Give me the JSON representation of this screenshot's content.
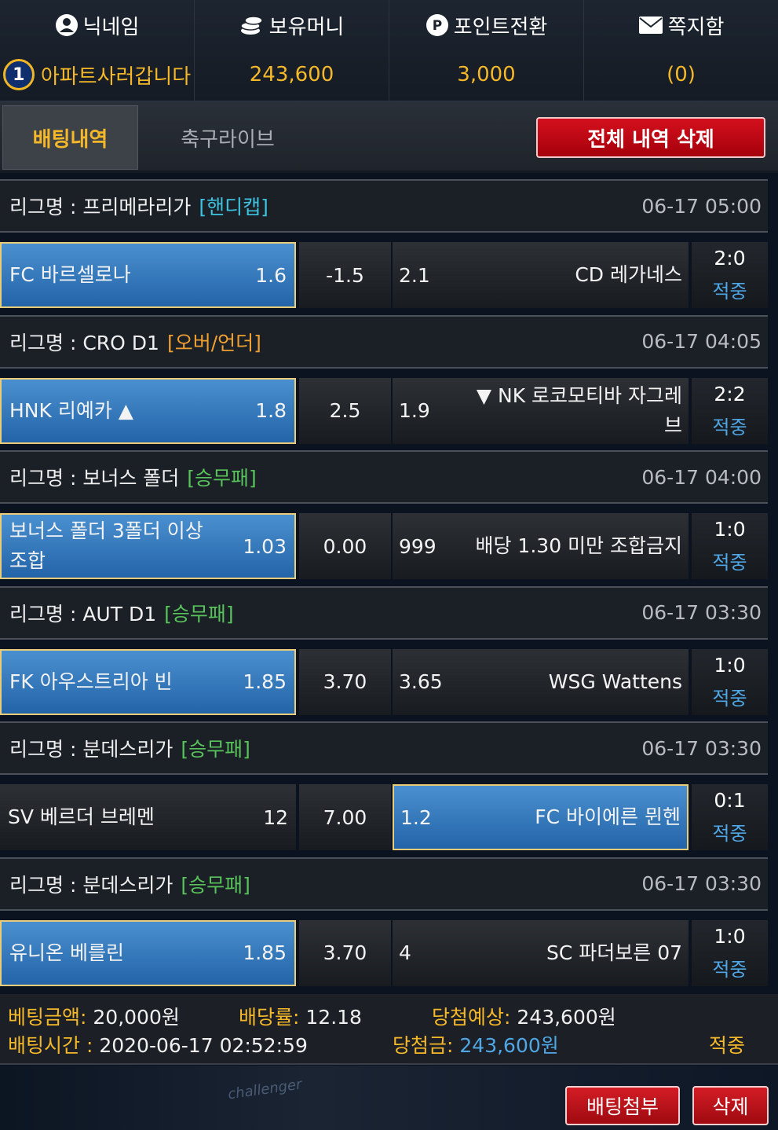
{
  "header": {
    "columns": [
      {
        "label": "닉네임",
        "icon": "user-circle-icon",
        "value": "아파트사러갑니다",
        "level": "1"
      },
      {
        "label": "보유머니",
        "icon": "coins-icon",
        "value": "243,600"
      },
      {
        "label": "포인트전환",
        "icon": "point-p-icon",
        "value": "3,000"
      },
      {
        "label": "쪽지함",
        "icon": "envelope-icon",
        "value": "(0)"
      }
    ]
  },
  "tabs": {
    "active": "배팅내역",
    "inactive": "축구라이브",
    "delete_all": "전체 내역 삭제"
  },
  "league_prefix": "리그명 : ",
  "matches": [
    {
      "league": "프리메라리가",
      "tag": "[핸디캡]",
      "tag_color": "#3cc3e0",
      "time": "06-17 05:00",
      "home": "FC 바르셀로나",
      "home_odds": "1.6",
      "line": "-1.5",
      "away_odds": "2.1",
      "away": "CD 레가네스",
      "score": "2:0",
      "status": "적중",
      "selected": "home"
    },
    {
      "league": "CRO D1",
      "tag": "[오버/언더]",
      "tag_color": "#f0a030",
      "time": "06-17 04:05",
      "home": "HNK 리예카 ▲",
      "home_odds": "1.8",
      "line": "2.5",
      "away_odds": "1.9",
      "away": "▼ NK 로코모티바 자그레브",
      "score": "2:2",
      "status": "적중",
      "selected": "home"
    },
    {
      "league": "보너스 폴더",
      "tag": "[승무패]",
      "tag_color": "#58c35a",
      "time": "06-17 04:00",
      "home": "보너스 폴더 3폴더 이상 조합",
      "home_odds": "1.03",
      "line": "0.00",
      "away_odds": "999",
      "away": "배당 1.30 미만 조합금지",
      "score": "1:0",
      "status": "적중",
      "selected": "home"
    },
    {
      "league": "AUT D1",
      "tag": "[승무패]",
      "tag_color": "#58c35a",
      "time": "06-17 03:30",
      "home": "FK 아우스트리아 빈",
      "home_odds": "1.85",
      "line": "3.70",
      "away_odds": "3.65",
      "away": "WSG Wattens",
      "score": "1:0",
      "status": "적중",
      "selected": "home"
    },
    {
      "league": "분데스리가",
      "tag": "[승무패]",
      "tag_color": "#58c35a",
      "time": "06-17 03:30",
      "home": "SV 베르더 브레멘",
      "home_odds": "12",
      "line": "7.00",
      "away_odds": "1.2",
      "away": "FC 바이에른 뮌헨",
      "score": "0:1",
      "status": "적중",
      "selected": "away"
    },
    {
      "league": "분데스리가",
      "tag": "[승무패]",
      "tag_color": "#58c35a",
      "time": "06-17 03:30",
      "home": "유니온 베를린",
      "home_odds": "1.85",
      "line": "3.70",
      "away_odds": "4",
      "away": "SC 파더보른 07",
      "score": "1:0",
      "status": "적중",
      "selected": "home"
    }
  ],
  "summary": {
    "bet_amount_label": "베팅금액:",
    "bet_amount": "20,000원",
    "odds_label": "배당률:",
    "odds": "12.18",
    "expected_label": "당첨예상:",
    "expected": "243,600원",
    "bet_time_label": "배팅시간 :",
    "bet_time": "2020-06-17 02:52:59",
    "win_label": "당첨금:",
    "win": "243,600원",
    "result": "적중"
  },
  "footer": {
    "attach_button": "배팅첨부",
    "delete_button": "삭제",
    "bg_text": "challenger"
  }
}
